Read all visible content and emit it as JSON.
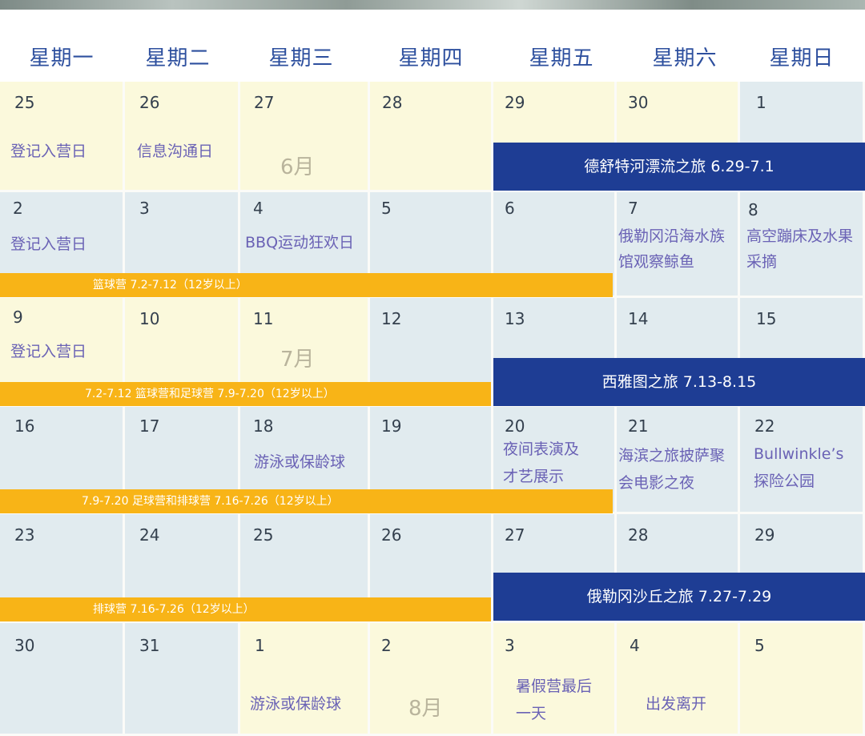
{
  "weekdays": [
    "星期一",
    "星期二",
    "星期三",
    "星期四",
    "星期五",
    "星期六",
    "星期日"
  ],
  "days": {
    "r1": [
      "25",
      "26",
      "27",
      "28",
      "29",
      "30",
      "1"
    ],
    "r2": [
      "2",
      "3",
      "4",
      "5",
      "6",
      "7",
      "8"
    ],
    "r3": [
      "9",
      "10",
      "11",
      "12",
      "13",
      "14",
      "15"
    ],
    "r4": [
      "16",
      "17",
      "18",
      "19",
      "20",
      "21",
      "22"
    ],
    "r5": [
      "23",
      "24",
      "25",
      "26",
      "27",
      "28",
      "29"
    ],
    "r6": [
      "30",
      "31",
      "1",
      "2",
      "3",
      "4",
      "5"
    ]
  },
  "events": {
    "r1_mon": "登记入营日",
    "r1_tue": "信息沟通日",
    "r2_mon": "登记入营日",
    "r2_wed": "BBQ运动狂欢日",
    "r2_sat_1": "俄勒冈沿海水族",
    "r2_sat_2": "馆观察鲸鱼",
    "r2_sun_1": "高空蹦床及水果",
    "r2_sun_2": "采摘",
    "r3_mon": "登记入营日",
    "r4_wed": "游泳或保龄球",
    "r4_fri_1": "夜间表演及",
    "r4_fri_2": "才艺展示",
    "r4_sat_1": "海滨之旅披萨聚",
    "r4_sat_2": "会电影之夜",
    "r4_sun_1": "Bullwinkle’s",
    "r4_sun_2": "探险公园",
    "r6_wed": "游泳或保龄球",
    "r6_fri_1": "暑假营最后",
    "r6_fri_2": "一天",
    "r6_sat": "出发离开"
  },
  "months": {
    "june": "6月",
    "july": "7月",
    "august": "8月"
  },
  "bars": {
    "deschutes": "德舒特河漂流之旅 6.29-7.1",
    "basketball": "篮球营 7.2-7.12（12岁以上）",
    "basket_soccer": "7.2-7.12 篮球营和足球营 7.9-7.20（12岁以上）",
    "seattle": "西雅图之旅 7.13-8.15",
    "soccer_volley": "7.9-7.20 足球营和排球营 7.16-7.26（12岁以上）",
    "dunes": "俄勒冈沙丘之旅 7.27-7.29",
    "volleyball": "排球营 7.16-7.26（12岁以上）"
  },
  "colors": {
    "weekday_text": "#2d4f9e",
    "event_text": "#6a62b5",
    "bar_orange": "#f8b417",
    "bar_navy": "#1e3d94",
    "cell_yellow": "#fbf9dc",
    "cell_blue": "#e1ebef"
  }
}
